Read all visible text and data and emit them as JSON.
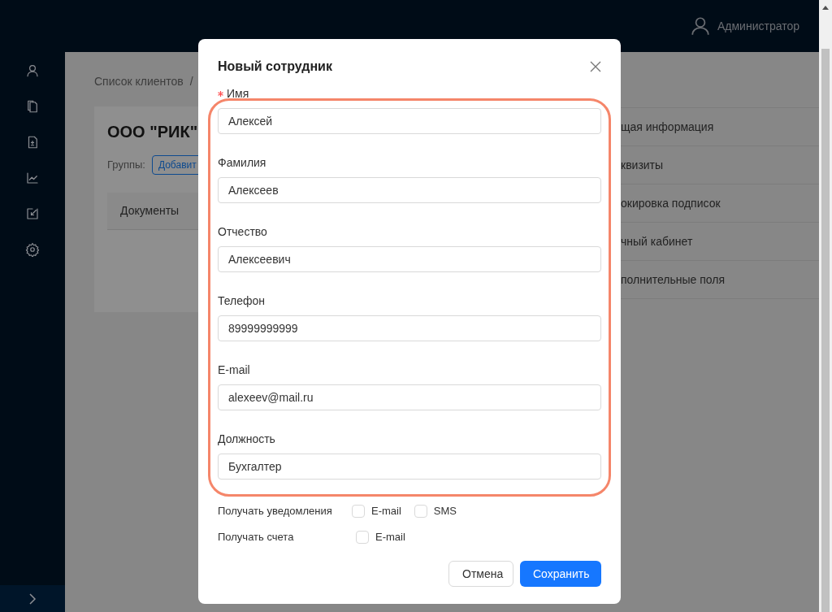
{
  "header": {
    "user": "Администратор"
  },
  "background": {
    "breadcrumb": [
      "Список клиентов",
      "/"
    ],
    "card": {
      "title": "ООО \"РИК\"",
      "groups_label": "Группы:",
      "add_button": "Добавит",
      "tab": "Документы"
    },
    "side_menu": [
      "щая информация",
      "квизиты",
      "окировка подписок",
      "чный кабинет",
      "полнительные поля"
    ]
  },
  "modal": {
    "title": "Новый сотрудник",
    "fields": [
      {
        "label": "Имя",
        "required": true,
        "value": "Алексей"
      },
      {
        "label": "Фамилия",
        "required": false,
        "value": "Алексеев"
      },
      {
        "label": "Отчество",
        "required": false,
        "value": "Алексеевич"
      },
      {
        "label": "Телефон",
        "required": false,
        "value": "89999999999"
      },
      {
        "label": "E-mail",
        "required": false,
        "value": "alexeev@mail.ru"
      },
      {
        "label": "Должность",
        "required": false,
        "value": "Бухгалтер"
      }
    ],
    "subscriptions": [
      {
        "label": "Получать уведомления",
        "options": [
          {
            "label": "E-mail",
            "checked": false
          },
          {
            "label": "SMS",
            "checked": false
          }
        ]
      },
      {
        "label": "Получать счета",
        "options": [
          {
            "label": "E-mail",
            "checked": false
          }
        ]
      }
    ],
    "buttons": [
      {
        "label": "Отмена",
        "kind": "default"
      },
      {
        "label": "Сохранить",
        "kind": "primary"
      }
    ]
  }
}
